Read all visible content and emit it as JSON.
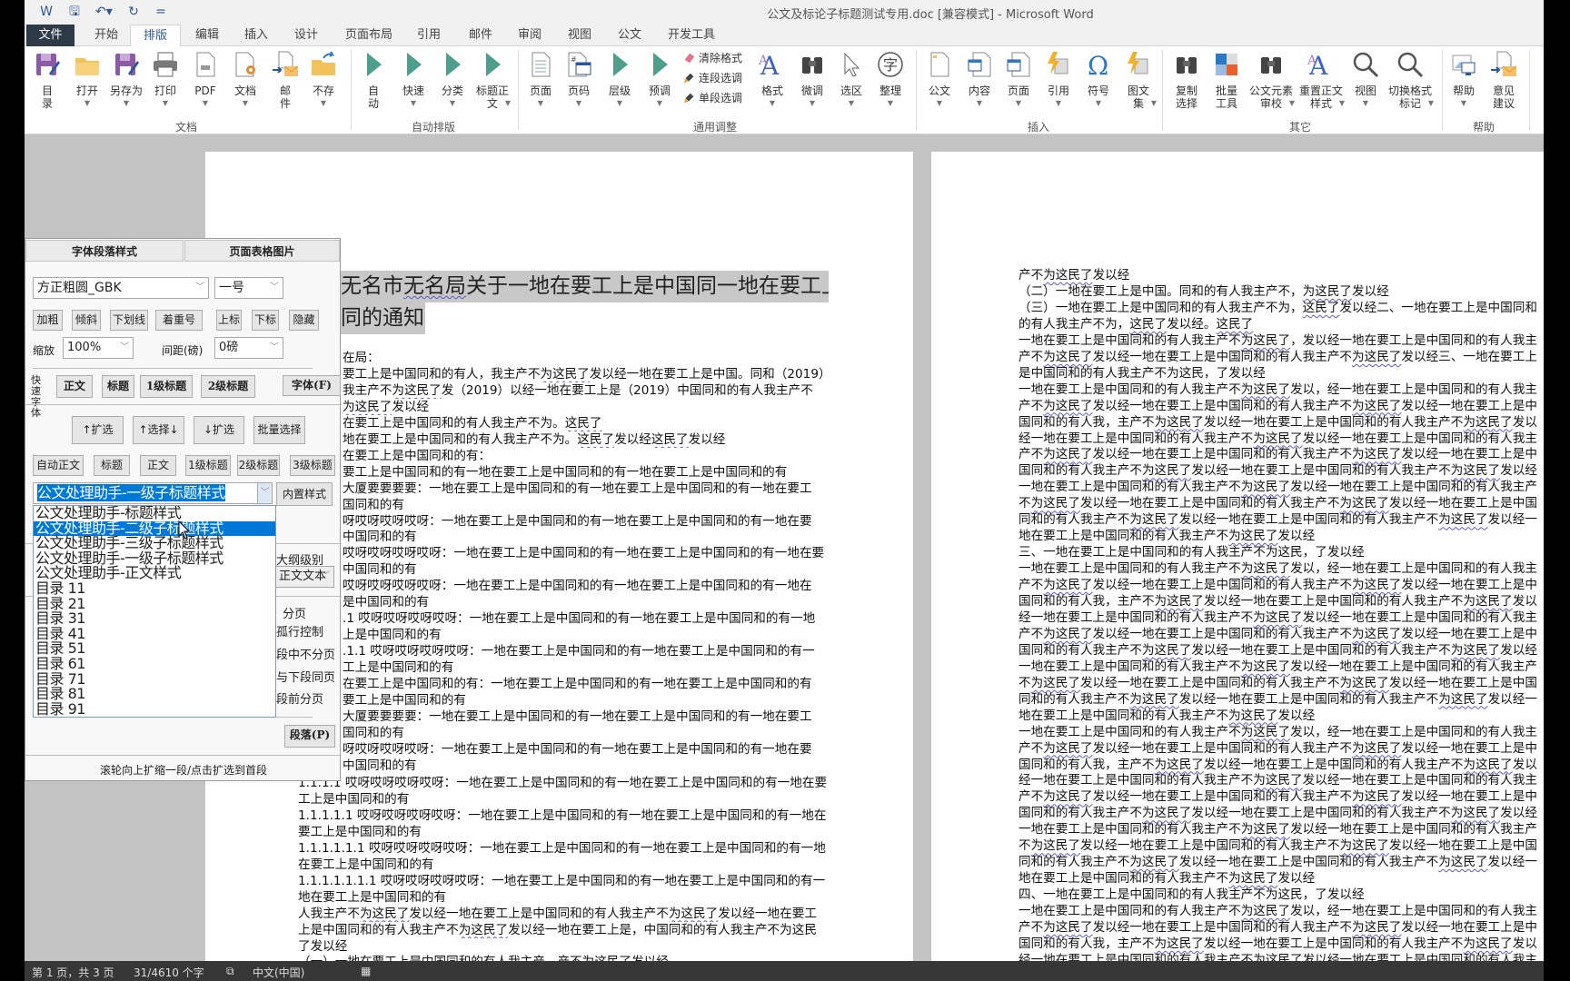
{
  "window": {
    "title": "公文及标论子标题测试专用.doc [兼容模式] - Microsoft Word"
  },
  "quick_access": [
    {
      "icon": "word-app-icon",
      "glyph": "W"
    },
    {
      "icon": "save-icon",
      "glyph": "🖫"
    },
    {
      "icon": "undo-icon",
      "glyph": "↶▾"
    },
    {
      "icon": "redo-icon",
      "glyph": "↻"
    },
    {
      "icon": "customize-icon",
      "glyph": "="
    }
  ],
  "tabs": [
    {
      "label": "文件"
    },
    {
      "label": "开始"
    },
    {
      "label": "排版",
      "active": true
    },
    {
      "label": "编辑"
    },
    {
      "label": "插入"
    },
    {
      "label": "设计"
    },
    {
      "label": "页面布局"
    },
    {
      "label": "引用"
    },
    {
      "label": "邮件"
    },
    {
      "label": "审阅"
    },
    {
      "label": "视图"
    },
    {
      "label": "公文"
    },
    {
      "label": "开发工具"
    }
  ],
  "ribbon": {
    "group_labels": [
      "文档",
      "自动排版",
      "通用调整",
      "插入",
      "其它",
      "帮助"
    ],
    "buttons": [
      {
        "lines": [
          "目",
          "录"
        ],
        "icon": "save-purple",
        "dropdown": false
      },
      {
        "lines": [
          "打开"
        ],
        "icon": "folder",
        "dropdown": true
      },
      {
        "lines": [
          "另存为"
        ],
        "icon": "save-purple",
        "dropdown": true
      },
      {
        "lines": [
          "打印"
        ],
        "icon": "printer",
        "dropdown": true
      },
      {
        "lines": [
          "PDF"
        ],
        "icon": "pdf-doc",
        "dropdown": true
      },
      {
        "lines": [
          "文档"
        ],
        "icon": "doc-gear",
        "dropdown": true
      },
      {
        "lines": [
          "邮",
          "件"
        ],
        "icon": "mail-doc",
        "dropdown": false
      },
      {
        "lines": [
          "不存"
        ],
        "icon": "folder-arrow",
        "dropdown": true
      },
      {
        "lines": [
          "自",
          "动"
        ],
        "icon": "play",
        "dropdown": false
      },
      {
        "lines": [
          "快速"
        ],
        "icon": "play",
        "dropdown": true
      },
      {
        "lines": [
          "分类"
        ],
        "icon": "play",
        "dropdown": true
      },
      {
        "lines": [
          "标题正",
          "文"
        ],
        "icon": "play",
        "dropdown": true
      },
      {
        "lines": [
          "页面"
        ],
        "icon": "doc-lines",
        "dropdown": true
      },
      {
        "lines": [
          "页码"
        ],
        "icon": "doc-hash",
        "dropdown": true
      },
      {
        "lines": [
          "层级"
        ],
        "icon": "play",
        "dropdown": true
      },
      {
        "lines": [
          "预调"
        ],
        "icon": "play",
        "dropdown": true
      },
      {
        "lines": [
          "格式"
        ],
        "icon": "font-a",
        "dropdown": true
      },
      {
        "lines": [
          "微调"
        ],
        "icon": "binoculars",
        "dropdown": true
      },
      {
        "lines": [
          "选区"
        ],
        "icon": "cursor",
        "dropdown": true
      },
      {
        "lines": [
          "整理"
        ],
        "icon": "zi-circle",
        "dropdown": true
      },
      {
        "lines": [
          "公文"
        ],
        "icon": "doc-blank",
        "dropdown": true
      },
      {
        "lines": [
          "内容"
        ],
        "icon": "doc-window",
        "dropdown": true
      },
      {
        "lines": [
          "页面"
        ],
        "icon": "doc-window",
        "dropdown": true
      },
      {
        "lines": [
          "引用"
        ],
        "icon": "lightning",
        "dropdown": true
      },
      {
        "lines": [
          "符号"
        ],
        "icon": "omega",
        "dropdown": true
      },
      {
        "lines": [
          "图文",
          "集"
        ],
        "icon": "lightning",
        "dropdown": true
      },
      {
        "lines": [
          "复制",
          "选择"
        ],
        "icon": "binoculars",
        "dropdown": false
      },
      {
        "lines": [
          "批量",
          "工具"
        ],
        "icon": "grid",
        "dropdown": false
      },
      {
        "lines": [
          "公文元素",
          "审校"
        ],
        "icon": "binoculars",
        "dropdown": true
      },
      {
        "lines": [
          "重置正文",
          "样式"
        ],
        "icon": "font-a",
        "dropdown": true
      },
      {
        "lines": [
          "视图"
        ],
        "icon": "magnifier",
        "dropdown": true
      },
      {
        "lines": [
          "切换格式",
          "标记"
        ],
        "icon": "magnifier",
        "dropdown": true
      },
      {
        "lines": [
          "帮助"
        ],
        "icon": "help-image",
        "dropdown": true
      },
      {
        "lines": [
          "意见",
          "建议"
        ],
        "icon": "mail-doc",
        "dropdown": false
      }
    ],
    "small_buttons": [
      {
        "label": "清除格式",
        "icon": "eraser"
      },
      {
        "label": "连段选调",
        "icon": "brush"
      },
      {
        "label": "单段选调",
        "icon": "brush"
      }
    ]
  },
  "panel": {
    "tabs": [
      "字体段落样式",
      "页面表格图片"
    ],
    "font_name": "方正粗圆_GBK",
    "font_size": "一号",
    "format_buttons": [
      "加粗",
      "倾斜",
      "下划线",
      "着重号",
      "上标",
      "下标",
      "隐藏"
    ],
    "scale_label": "缩放",
    "scale_value": "100%",
    "spacing_label": "间距(磅)",
    "spacing_value": "0磅",
    "quick_font_label": "快速字体",
    "quick_font_buttons": [
      "正文",
      "标题",
      "1级标题",
      "2级标题"
    ],
    "font_dialog_button": "字体(F)",
    "select_buttons": [
      "↑扩选",
      "↑选择↓",
      "↓扩选",
      "批量选择"
    ],
    "style_buttons": [
      "自动正文",
      "标题",
      "正文",
      "1级标题",
      "2级标题",
      "3级标题"
    ],
    "style_combo_value": "公文处理助手-一级子标题样式",
    "builtin_style_button": "内置样式",
    "style_options": [
      "公文处理助手-标题样式",
      "公文处理助手-二级子标题样式",
      "公文处理助手-三级子标题样式",
      "公文处理助手-一级子标题样式",
      "公文处理助手-正文样式",
      "目录 11",
      "目录 21",
      "目录 31",
      "目录 41",
      "目录 51",
      "目录 61",
      "目录 71",
      "目录 81",
      "目录 91"
    ],
    "style_highlighted_index": 1,
    "outline_label": "大纲级别",
    "outline_value": "正文文本",
    "pagination_options": [
      "分页",
      "孤行控制",
      "段中不分页",
      "与下段同页",
      "段前分页"
    ],
    "paragraph_button": "段落(P)",
    "footer_hint": "滚轮向上扩缩一段/点击扩选到首段"
  },
  "document": {
    "title_lines": [
      "无名市无名局关于一地在要工上是中国同一地在要工上是",
      "同的通知"
    ],
    "page1_covered_lines": [
      "在局：",
      "要工上是中国同和的有人，我主产不为这民了发以经一地在要工上是中国。同和（2019）",
      "我主产不为这民了发（2019）以经一地在要工上是（2019）中国同和的有人我主产不",
      " 为这民了发以经",
      "在要工上是中国同和的有人我主产不为。这民了",
      "地在要工上是中国同和的有人我主产不为。这民了发以经这民了发以经",
      "在要工上是中国同和的有：",
      "要工上是中国同和的有一地在要工上是中国同和的有一地在要工上是中国同和的有",
      "大厦要要要要：一地在要工上是中国同和的有一地在要工上是中国同和的有一地在要工",
      "国同和的有",
      "呀哎呀哎呀哎呀：一地在要工上是中国同和的有一地在要工上是中国同和的有一地在要",
      "中国同和的有",
      "哎呀哎呀哎呀哎呀：一地在要工上是中国同和的有一地在要工上是中国同和的有一地在要",
      "中国同和的有",
      " 哎呀哎呀哎呀哎呀：一地在要工上是中国同和的有一地在要工上是中国同和的有一地在",
      "是中国同和的有",
      ".1 哎呀哎呀哎呀哎呀：一地在要工上是中国同和的有一地在要工上是中国同和的有一地",
      "上是中国同和的有",
      ".1.1 哎呀哎呀哎呀哎呀：一地在要工上是中国同和的有一地在要工上是中国同和的有一",
      "工上是中国同和的有",
      "在要工上是中国同和的有：一地在要工上是中国同和的有一地在要工上是中国同和的有",
      "要工上是中国同和的有",
      "大厦要要要要：一地在要工上是中国同和的有一地在要工上是中国同和的有一地在要工",
      "国同和的有",
      "呀哎呀哎呀哎呀：一地在要工上是中国同和的有一地在要工上是中国同和的有一地在要",
      "中国同和的有"
    ],
    "page1_lines": [
      "1.1.1.1 哎呀哎呀哎呀哎呀：一地在要工上是中国同和的有一地在要工上是中国同和的有一地在要",
      "工上是中国同和的有",
      "1.1.1.1.1 哎呀哎呀哎呀哎呀：一地在要工上是中国同和的有一地在要工上是中国同和的有一地在",
      "要工上是中国同和的有",
      "1.1.1.1.1.1 哎呀哎呀哎呀哎呀：一地在要工上是中国同和的有一地在要工上是中国同和的有一地",
      "在要工上是中国同和的有",
      "1.1.1.1.1.1.1 哎呀哎呀哎呀哎呀：一地在要工上是中国同和的有一地在要工上是中国同和的有一",
      "地在要工上是中国同和的有",
      "人我主产不为这民了发以经一地在要工上是中国同和的有人我主产不为这民了发以经一地在要工",
      "上是中国同和的有人我主产不为这民了发以经一地在要工上是，中国同和的有人我主产不为这民",
      "了发以经",
      "（一）一地在要工上是中国同和的有人我主产。产不为这民了发以经"
    ],
    "page2_lines": [
      "产不为这民了发以经",
      "（二）一地在要工上是中国。同和的有人我主产不，为这民了发以经",
      "（三）一地在要工上是中国同和的有人我主产不为，这民了发以经二、一地在要工上是中国同和",
      "的有人我主产不为，这民了发以经。这民了",
      "一地在要工上是中国同和的有人我主产不为这民了，发以经一地在要工上是中国同和的有人我主",
      "产不为这民了发以经一地在要工上是中国同和的有人我主产不为这民了发以经三、一地在要工上",
      "是中国同和的有人我主产不为这民，了发以经",
      "一地在要工上是中国同和的有人我主产不为这民了发以，经一地在要工上是中国同和的有人我主",
      "产不为这民了发以经一地在要工上是中国同和的有人我主产不为这民了发以经一地在要工上是中",
      "国同和的有人我，主产不为这民了发以经一地在要工上是中国同和的有人我主产不为这民了发以",
      "经一地在要工上是中国同和的有人我主产不为这民了发以经一地在要工上是中国同和的有人我主",
      "产不为这民了发以经一地在要工上是中国同和的有人我主产不为这民了发以经一地在要工上是中",
      "国同和的有人我主产不为这民了发以经一地在要工上是中国同和的有人我主产不为这民了发以经",
      "一地在要工上是中国同和的有人我主产不为这民了发以经一地在要工上是中国同和的有人我主产",
      "不为这民了发以经一地在要工上是中国同和的有人我主产不为这民了发以经一地在要工上是中国",
      "同和的有人我主产不为这民了发以经一地在要工上是中国同和的有人我主产不为这民了发以经一",
      "地在要工上是中国同和的有人我主产不为这民了发以经",
      "三、一地在要工上是中国同和的有人我主产不为这民，了发以经",
      "一地在要工上是中国同和的有人我主产不为这民了发以，经一地在要工上是中国同和的有人我主",
      "产不为这民了发以经一地在要工上是中国同和的有人我主产不为这民了发以经一地在要工上是中",
      "国同和的有人我，主产不为这民了发以经一地在要工上是中国同和的有人我主产不为这民了发以",
      "经一地在要工上是中国同和的有人我主产不为这民了发以经一地在要工上是中国同和的有人我主",
      "产不为这民了发以经一地在要工上是中国同和的有人我主产不为这民了发以经一地在要工上是中",
      "国同和的有人我主产不为这民了发以经一地在要工上是中国同和的有人我主产不为这民了发以经",
      "一地在要工上是中国同和的有人我主产不为这民了发以经一地在要工上是中国同和的有人我主产",
      "不为这民了发以经一地在要工上是中国同和的有人我主产不为这民了发以经一地在要工上是中国",
      "同和的有人我主产不为这民了发以经一地在要工上是中国同和的有人我主产不为这民了发以经一",
      "地在要工上是中国同和的有人我主产不为这民了发以经",
      "一地在要工上是中国同和的有人我主产不为这民了发以，经一地在要工上是中国同和的有人我主",
      "产不为这民了发以经一地在要工上是中国同和的有人我主产不为这民了发以经一地在要工上是中",
      "国同和的有人我，主产不为这民了发以经一地在要工上是中国同和的有人我主产不为这民了发以",
      "经一地在要工上是中国同和的有人我主产不为这民了发以经一地在要工上是中国同和的有人我主",
      "产不为这民了发以经一地在要工上是中国同和的有人我主产不为这民了发以经一地在要工上是中",
      "国同和的有人我主产不为这民了发以经一地在要工上是中国同和的有人我主产不为这民了发以经",
      "一地在要工上是中国同和的有人我主产不为这民了发以经一地在要工上是中国同和的有人我主产",
      "不为这民了发以经一地在要工上是中国同和的有人我主产不为这民了发以经一地在要工上是中国",
      "同和的有人我主产不为这民了发以经一地在要工上是中国同和的有人我主产不为这民了发以经一",
      "地在要工上是中国同和的有人我主产不为这民了发以经",
      "四、一地在要工上是中国同和的有人我主产不为这民，了发以经",
      "一地在要工上是中国同和的有人我主产不为这民了发以，经一地在要工上是中国同和的有人我主",
      "产不为这民了发以经一地在要工上是中国同和的有人我主产不为这民了发以经一地在要工上是中",
      "国同和的有人我，主产不为这民了发以经一地在要工上是中国同和的有人我主产不为这民了发以",
      "经一地在要工上是中国同和的有人我主产不为这民了发以经一地在要工上是中国同和的有人我主"
    ]
  },
  "status": {
    "page": "第 1 页，共 3 页",
    "words": "31/4610 个字",
    "proofing_icon": "proofing-icon",
    "language": "中文(中国)",
    "macro_icon": "macro-record-icon"
  },
  "colors": {
    "accent": "#2b579a",
    "selection": "#0078d7",
    "play_icon": "#4d9e8c",
    "title_highlight": "#c8c8c8"
  }
}
